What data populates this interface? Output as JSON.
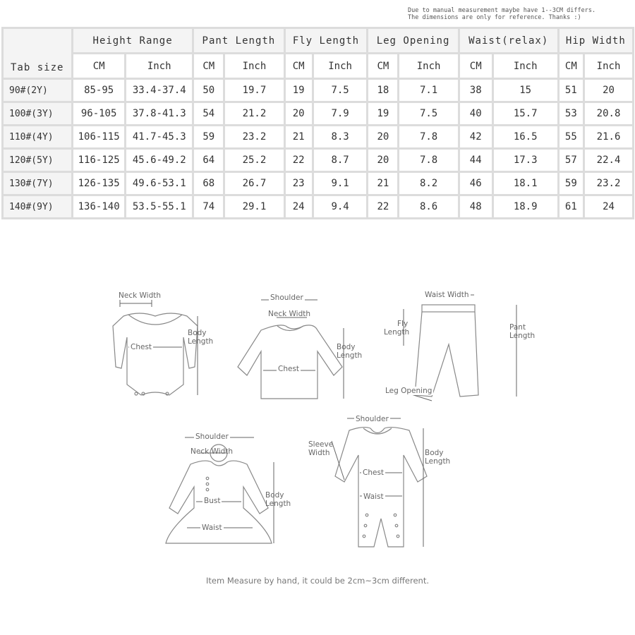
{
  "note": {
    "line1": "Due to manual measurement maybe have 1--3CM differs.",
    "line2": "The dimensions are only for reference. Thanks :)"
  },
  "table": {
    "tab_header": "Tab size",
    "groups": [
      "Height Range",
      "Pant Length",
      "Fly Length",
      "Leg Opening",
      "Waist(relax)",
      "Hip Width"
    ],
    "units": [
      "CM",
      "Inch",
      "CM",
      "Inch",
      "CM",
      "Inch",
      "CM",
      "Inch",
      "CM",
      "Inch",
      "CM",
      "Inch"
    ],
    "rows": [
      {
        "tab": "90#(2Y)",
        "cells": [
          "85-95",
          "33.4-37.4",
          "50",
          "19.7",
          "19",
          "7.5",
          "18",
          "7.1",
          "38",
          "15",
          "51",
          "20"
        ]
      },
      {
        "tab": "100#(3Y)",
        "cells": [
          "96-105",
          "37.8-41.3",
          "54",
          "21.2",
          "20",
          "7.9",
          "19",
          "7.5",
          "40",
          "15.7",
          "53",
          "20.8"
        ]
      },
      {
        "tab": "110#(4Y)",
        "cells": [
          "106-115",
          "41.7-45.3",
          "59",
          "23.2",
          "21",
          "8.3",
          "20",
          "7.8",
          "42",
          "16.5",
          "55",
          "21.6"
        ]
      },
      {
        "tab": "120#(5Y)",
        "cells": [
          "116-125",
          "45.6-49.2",
          "64",
          "25.2",
          "22",
          "8.7",
          "20",
          "7.8",
          "44",
          "17.3",
          "57",
          "22.4"
        ]
      },
      {
        "tab": "130#(7Y)",
        "cells": [
          "126-135",
          "49.6-53.1",
          "68",
          "26.7",
          "23",
          "9.1",
          "21",
          "8.2",
          "46",
          "18.1",
          "59",
          "23.2"
        ]
      },
      {
        "tab": "140#(9Y)",
        "cells": [
          "136-140",
          "53.5-55.1",
          "74",
          "29.1",
          "24",
          "9.4",
          "22",
          "8.6",
          "48",
          "18.9",
          "61",
          "24"
        ]
      }
    ]
  },
  "diagrams": {
    "bodysuit": {
      "neck": "Neck Width",
      "chest": "Chest",
      "body_line1": "Body",
      "body_line2": "Length"
    },
    "shirt": {
      "shoulder": "Shoulder",
      "neck": "Neck Width",
      "chest": "Chest",
      "body_line1": "Body",
      "body_line2": "Length"
    },
    "pants": {
      "waist": "Waist Width",
      "fly_line1": "Fly",
      "fly_line2": "Length",
      "leg": "Leg Opening",
      "pant_line1": "Pant",
      "pant_line2": "Length"
    },
    "dress": {
      "shoulder": "Shoulder",
      "neck": "Neck Width",
      "bust": "Bust",
      "waist": "Waist",
      "body_line1": "Body",
      "body_line2": "Length"
    },
    "romper": {
      "shoulder": "Shoulder",
      "sleeve_line1": "Sleeve",
      "sleeve_line2": "Width",
      "chest": "Chest",
      "waist": "Waist",
      "body_line1": "Body",
      "body_line2": "Length"
    }
  },
  "footer": "Item Measure by hand, it could be 2cm~3cm different."
}
